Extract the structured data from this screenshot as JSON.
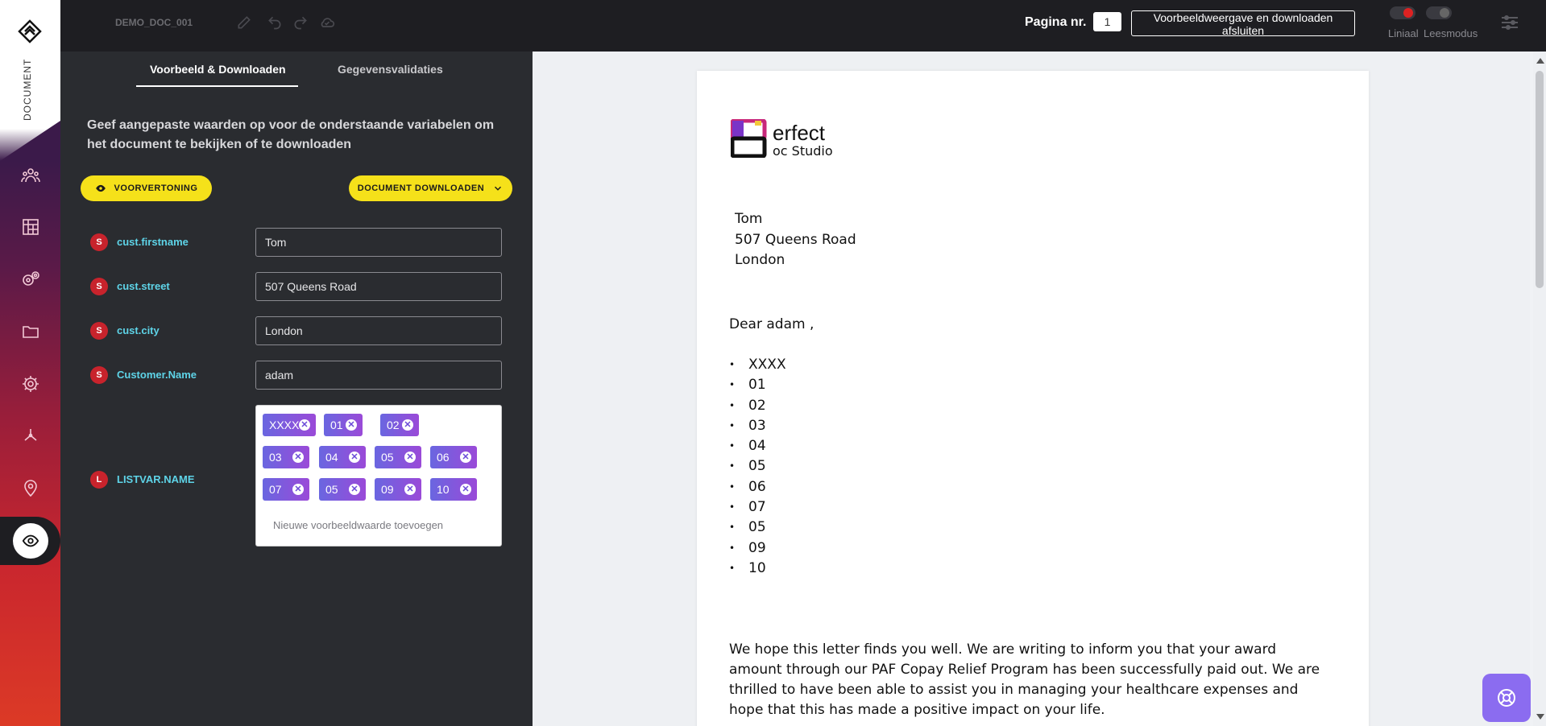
{
  "rail": {
    "label": "DOCUMENT",
    "nav_icons": [
      "people-icon",
      "blueprint-icon",
      "gears-icon",
      "folder-icon",
      "settings-icon",
      "network-icon",
      "map-pin-icon",
      "eye-icon"
    ]
  },
  "topbar": {
    "doc_name": "DEMO_DOC_001",
    "page_label": "Pagina nr.",
    "page_number": "1",
    "close_preview": "Voorbeeldweergave en downloaden afsluiten",
    "ruler_label": "Liniaal",
    "reading_label": "Leesmodus"
  },
  "panel": {
    "tabs": [
      "Voorbeeld & Downloaden",
      "Gegevensvalidaties"
    ],
    "active_tab": 0,
    "instructions": "Geef aangepaste waarden op voor de onderstaande variabelen om het document te bekijken of te downloaden",
    "preview_button": "VOORVERTONING",
    "download_button": "DOCUMENT DOWNLOADEN",
    "variables": [
      {
        "badge": "S",
        "name": "cust.firstname",
        "value": "Tom"
      },
      {
        "badge": "S",
        "name": "cust.street",
        "value": "507 Queens Road"
      },
      {
        "badge": "S",
        "name": "cust.city",
        "value": "London"
      },
      {
        "badge": "S",
        "name": "Customer.Name",
        "value": "adam"
      }
    ],
    "list_var": {
      "badge": "L",
      "name": "LISTVAR.NAME",
      "chips": [
        "XXXX",
        "01",
        "02",
        "03",
        "04",
        "05",
        "06",
        "07",
        "05",
        "09",
        "10"
      ],
      "placeholder": "Nieuwe voorbeeldwaarde toevoegen"
    }
  },
  "document": {
    "brand_line1": "erfect",
    "brand_line2": "oc Studio",
    "address": [
      "Tom",
      "507 Queens Road",
      "London"
    ],
    "greeting": "Dear adam  ,",
    "bullets": [
      "XXXX",
      "01",
      "02",
      "03",
      "04",
      "05",
      "06",
      "07",
      "05",
      "09",
      "10"
    ],
    "paragraph": "We hope this letter finds you well. We are writing to inform you that your award amount through our PAF Copay Relief Program has been successfully paid out. We are thrilled to have been able to assist you in managing your healthcare expenses and hope that this has made a positive impact on your life."
  },
  "colors": {
    "accent_yellow": "#f5e11a",
    "variable_cyan": "#5ed4e8",
    "badge_red": "#c8232c",
    "chip_purple": "#9a4ad8",
    "help_purple": "#8b6cf0"
  }
}
